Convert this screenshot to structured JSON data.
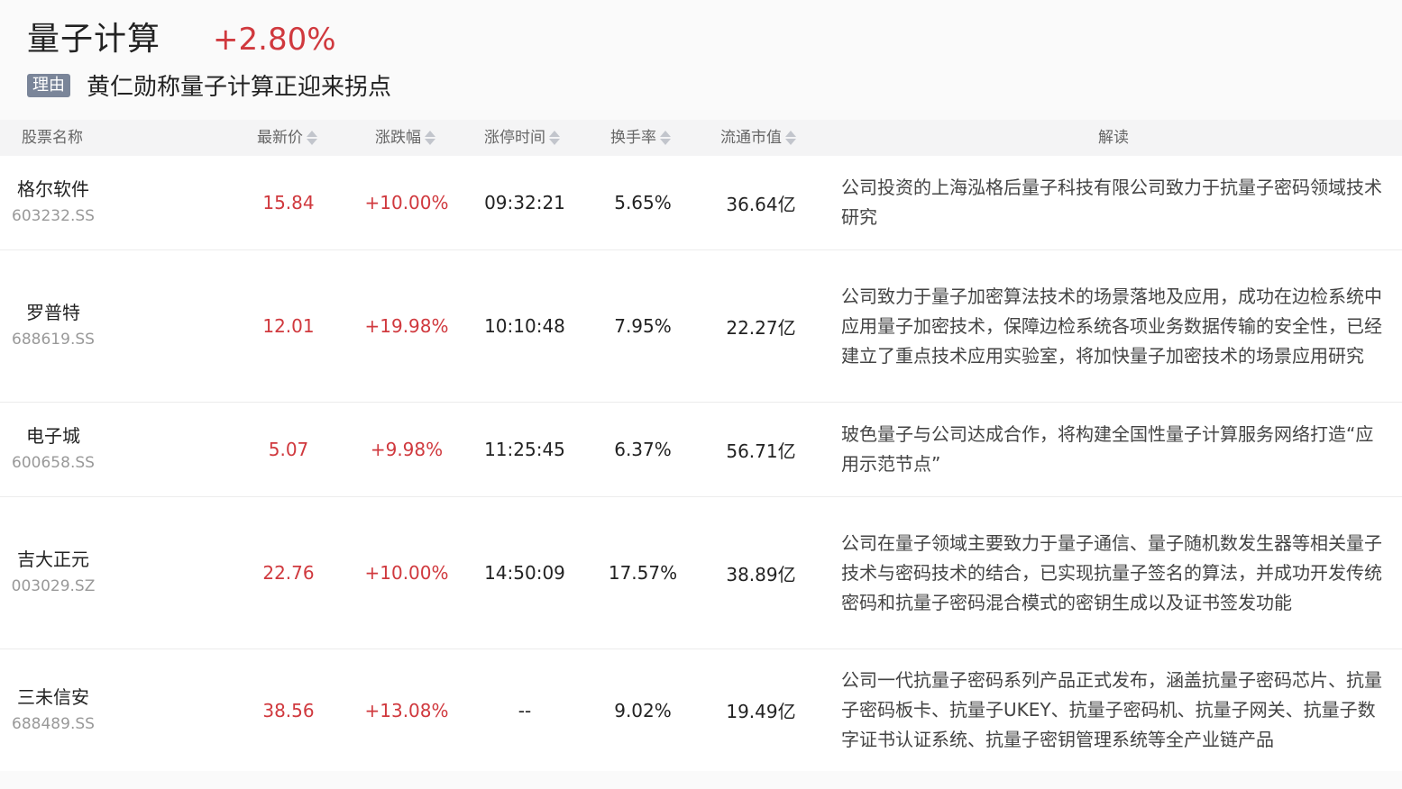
{
  "header": {
    "sector_name": "量子计算",
    "sector_change": "+2.80%",
    "reason_tag": "理由",
    "reason_text": "黄仁勋称量子计算正迎来拐点"
  },
  "table": {
    "columns": [
      "股票名称",
      "最新价",
      "涨跌幅",
      "涨停时间",
      "换手率",
      "流通市值",
      "解读"
    ],
    "rows": [
      {
        "name": "格尔软件",
        "code": "603232.SS",
        "price": "15.84",
        "change": "+10.00%",
        "limit_time": "09:32:21",
        "turnover": "5.65%",
        "float_cap": "36.64亿",
        "desc": "公司投资的上海泓格后量子科技有限公司致力于抗量子密码领域技术研究"
      },
      {
        "name": "罗普特",
        "code": "688619.SS",
        "price": "12.01",
        "change": "+19.98%",
        "limit_time": "10:10:48",
        "turnover": "7.95%",
        "float_cap": "22.27亿",
        "desc": "公司致力于量子加密算法技术的场景落地及应用，成功在边检系统中应用量子加密技术，保障边检系统各项业务数据传输的安全性，已经建立了重点技术应用实验室，将加快量子加密技术的场景应用研究"
      },
      {
        "name": "电子城",
        "code": "600658.SS",
        "price": "5.07",
        "change": "+9.98%",
        "limit_time": "11:25:45",
        "turnover": "6.37%",
        "float_cap": "56.71亿",
        "desc": "玻色量子与公司达成合作，将构建全国性量子计算服务网络打造“应用示范节点”"
      },
      {
        "name": "吉大正元",
        "code": "003029.SZ",
        "price": "22.76",
        "change": "+10.00%",
        "limit_time": "14:50:09",
        "turnover": "17.57%",
        "float_cap": "38.89亿",
        "desc": "公司在量子领域主要致力于量子通信、量子随机数发生器等相关量子技术与密码技术的结合，已实现抗量子签名的算法，并成功开发传统密码和抗量子密码混合模式的密钥生成以及证书签发功能"
      },
      {
        "name": "三未信安",
        "code": "688489.SS",
        "price": "38.56",
        "change": "+13.08%",
        "limit_time": "--",
        "turnover": "9.02%",
        "float_cap": "19.49亿",
        "desc": "公司一代抗量子密码系列产品正式发布，涵盖抗量子密码芯片、抗量子密码板卡、抗量子UKEY、抗量子密码机、抗量子网关、抗量子数字证书认证系统、抗量子密钥管理系统等全产业链产品"
      }
    ]
  },
  "colors": {
    "up": "#d0393e",
    "tag_bg": "#7a8599",
    "header_bg": "#f4f4f5"
  }
}
